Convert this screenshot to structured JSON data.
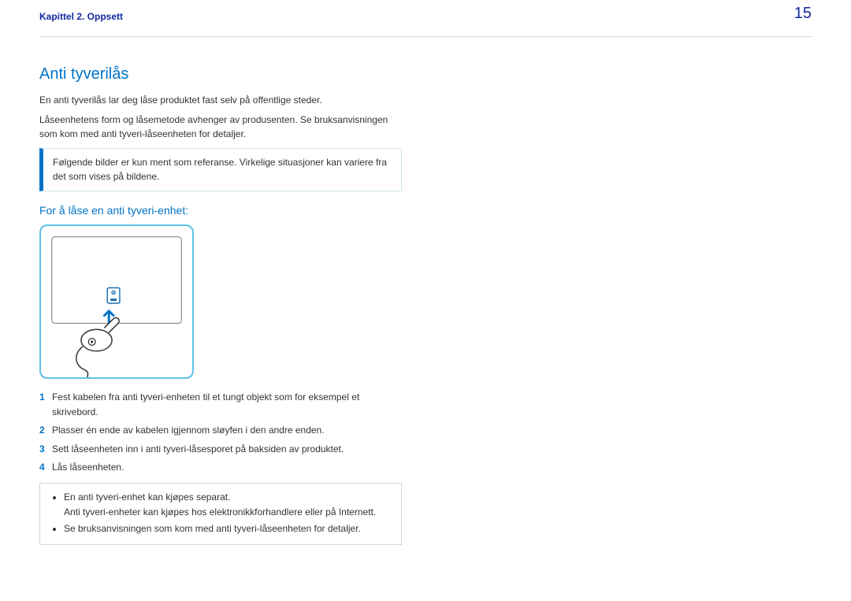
{
  "header": {
    "chapter": "Kapittel 2. Oppsett",
    "page_number": "15"
  },
  "section": {
    "heading": "Anti tyverilås",
    "paragraphs": [
      "En anti tyverilås lar deg låse produktet fast selv på offentlige steder.",
      "Låseenhetens form og låsemetode avhenger av produsenten. Se bruksanvisningen som kom med anti tyveri-låseenheten for detaljer."
    ],
    "note": "Følgende bilder er kun ment som referanse. Virkelige situasjoner kan variere fra det som vises på bildene.",
    "sub_heading": "For å låse en anti tyveri-enhet:",
    "steps": [
      {
        "n": "1",
        "text": "Fest kabelen fra anti tyveri-enheten til et tungt objekt som for eksempel et skrivebord."
      },
      {
        "n": "2",
        "text": "Plasser én ende av kabelen igjennom sløyfen i den andre enden."
      },
      {
        "n": "3",
        "text": "Sett låseenheten inn i anti tyveri-låsesporet på baksiden av produktet."
      },
      {
        "n": "4",
        "text": "Lås låseenheten."
      }
    ],
    "bullets": [
      "En anti tyveri-enhet kan kjøpes separat.",
      "Anti tyveri-enheter kan kjøpes hos elektronikkforhandlere eller på Internett.",
      "Se bruksanvisningen som kom med anti tyveri-låseenheten for detaljer."
    ]
  }
}
